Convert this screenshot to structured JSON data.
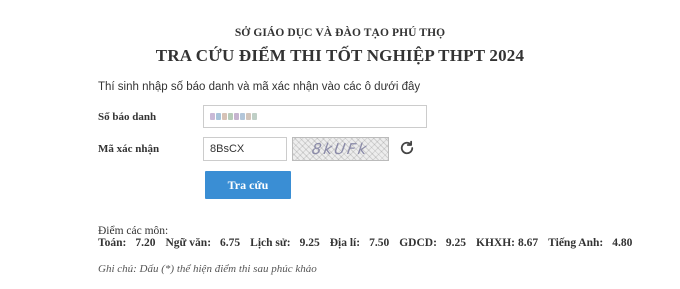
{
  "header": {
    "department": "SỞ GIÁO DỤC VÀ ĐÀO TẠO PHÚ THỌ",
    "title": "TRA CỨU ĐIỂM THI TỐT NGHIỆP THPT 2024"
  },
  "form": {
    "instruction": "Thí sinh nhập số báo danh và mã xác nhận vào các ô dưới đây",
    "sbd_label": "Số báo danh",
    "sbd_value_obscured": true,
    "captcha_label": "Mã xác nhận",
    "captcha_input_value": "8BsCX",
    "captcha_image_text": "8kUFk",
    "submit_label": "Tra cứu",
    "refresh_icon": "refresh-icon"
  },
  "scores": {
    "heading": "Điểm các môn:",
    "items": [
      {
        "label": "Toán:",
        "value": "7.20"
      },
      {
        "label": "Ngữ văn:",
        "value": "6.75"
      },
      {
        "label": "Lịch sử:",
        "value": "9.25"
      },
      {
        "label": "Địa lí:",
        "value": "7.50"
      },
      {
        "label": "GDCD:",
        "value": "9.25"
      },
      {
        "label": "KHXH:",
        "value": "8.67"
      },
      {
        "label": "Tiếng Anh:",
        "value": "4.80"
      }
    ]
  },
  "note": "Ghi chú: Dấu (*) thể hiện điểm thi sau phúc khảo",
  "colors": {
    "accent": "#3a8ed4",
    "text": "#333333",
    "border": "#cccccc"
  }
}
